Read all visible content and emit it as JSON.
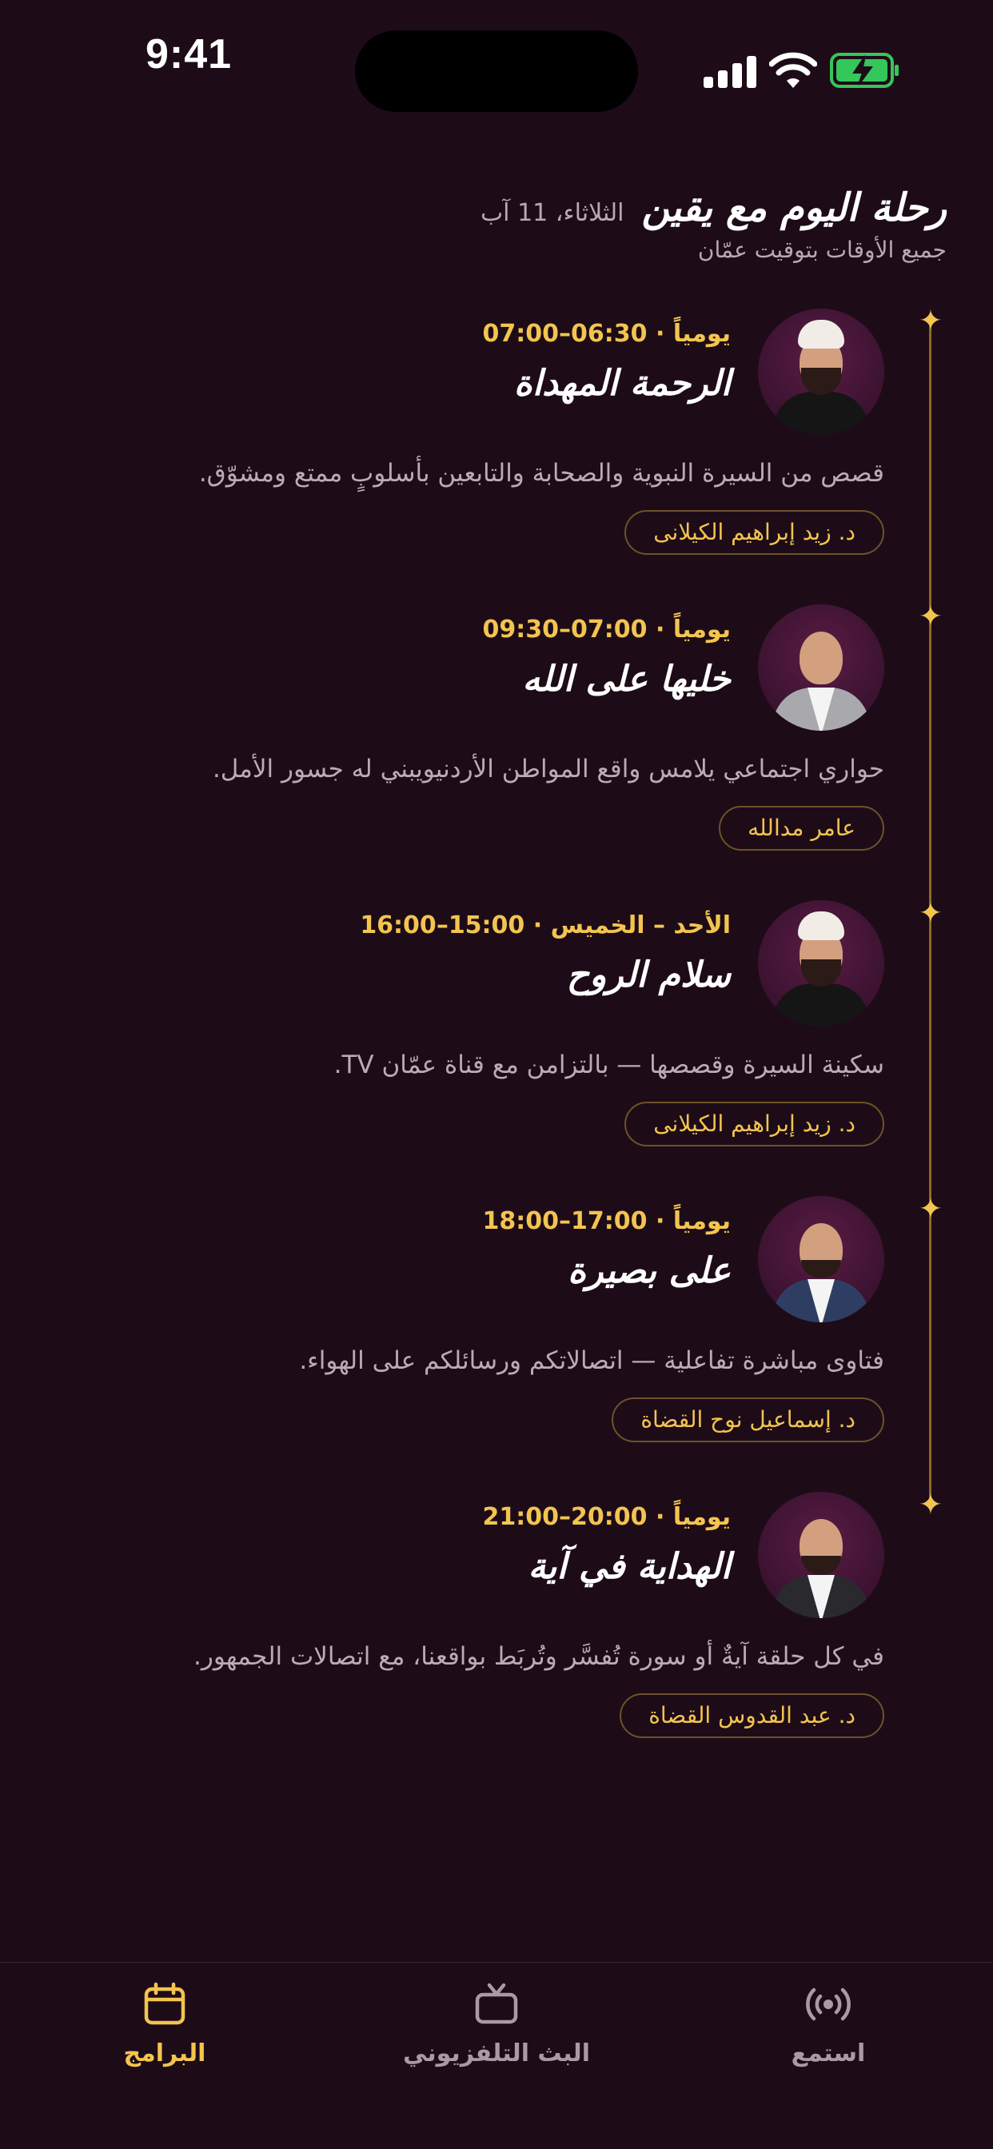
{
  "status_bar": {
    "time": "9:41"
  },
  "header": {
    "title": "رحلة اليوم مع يقين",
    "date": "الثلاثاء، 11 آب",
    "subtitle": "جميع الأوقات بتوقيت عمّان"
  },
  "programs": [
    {
      "schedule": "يومياً · 06:30–07:00",
      "title": "الرحمة المهداة",
      "description": "قصص من السيرة النبوية والصحابة والتابعين بأسلوبٍ ممتع ومشوّق.",
      "host": "د. زيد إبراهيم الكيلانى",
      "avatar": "host-photo-icon"
    },
    {
      "schedule": "يومياً · 07:00–09:30",
      "title": "خليها على الله",
      "description": "حواري اجتماعي يلامس واقع المواطن الأردنيويبني له جسور الأمل.",
      "host": "عامر مدالله",
      "avatar": "host-photo-icon"
    },
    {
      "schedule": "الأحد – الخميس · 15:00–16:00",
      "title": "سلام الروح",
      "description": "سكينة السيرة وقصصها — بالتزامن مع قناة عمّان TV.",
      "host": "د. زيد إبراهيم الكيلانى",
      "avatar": "host-photo-icon"
    },
    {
      "schedule": "يومياً · 17:00–18:00",
      "title": "على بصيرة",
      "description": "فتاوى مباشرة تفاعلية — اتصالاتكم ورسائلكم على الهواء.",
      "host": "د. إسماعيل نوح القضاة",
      "avatar": "host-photo-icon"
    },
    {
      "schedule": "يومياً · 20:00–21:00",
      "title": "الهداية في آية",
      "description": "في كل حلقة آيةٌ أو سورة تُفسَّر وتُربَط بواقعنا، مع اتصالات الجمهور.",
      "host": "د. عبد القدوس القضاة",
      "avatar": "host-photo-icon"
    }
  ],
  "tab_bar": {
    "tabs": [
      {
        "label": "البرامج",
        "icon": "calendar-icon",
        "active": true
      },
      {
        "label": "البث التلفزيوني",
        "icon": "tv-icon",
        "active": false
      },
      {
        "label": "استمع",
        "icon": "broadcast-icon",
        "active": false
      }
    ]
  },
  "colors": {
    "background": "#1d0c18",
    "accent": "#f3c44f",
    "muted_text": "#b9acb5",
    "inactive_tab": "#a99aa4"
  }
}
